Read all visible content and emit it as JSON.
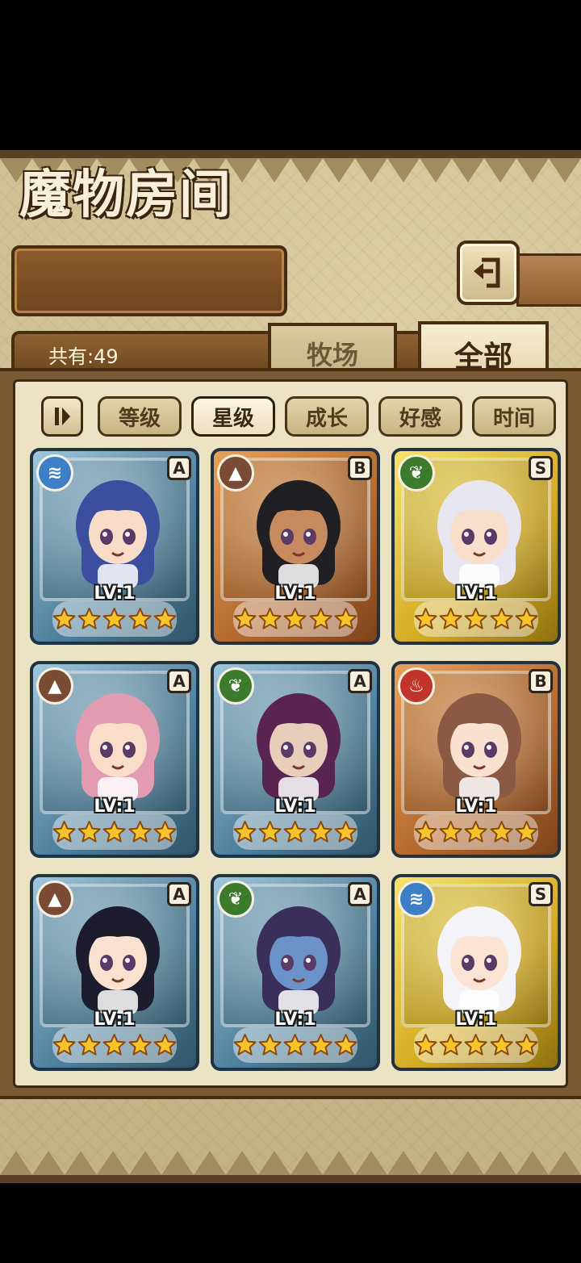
{
  "header": {
    "title": "魔物房间",
    "count_label": "共有:49"
  },
  "tabs": [
    {
      "label": "牧场",
      "active": false
    },
    {
      "label": "全部",
      "active": true
    }
  ],
  "filters": [
    {
      "label": "等级",
      "active": false
    },
    {
      "label": "星级",
      "active": true
    },
    {
      "label": "成长",
      "active": false
    },
    {
      "label": "好感",
      "active": false
    },
    {
      "label": "时间",
      "active": false
    }
  ],
  "monsters": [
    {
      "element": "water-icon",
      "grade": "A",
      "level": "LV:1",
      "stars": 5,
      "rarity": "a",
      "hair": "#3b4f9e",
      "skin": "#f8dcc8"
    },
    {
      "element": "earth-icon",
      "grade": "B",
      "level": "LV:1",
      "stars": 5,
      "rarity": "b",
      "hair": "#1f1f24",
      "skin": "#c68a5e"
    },
    {
      "element": "leaf-icon",
      "grade": "S",
      "level": "LV:1",
      "stars": 5,
      "rarity": "s",
      "hair": "#e8e6f0",
      "skin": "#f9dfcb"
    },
    {
      "element": "earth-icon",
      "grade": "A",
      "level": "LV:1",
      "stars": 5,
      "rarity": "a",
      "hair": "#e39bb2",
      "skin": "#f9ddc8"
    },
    {
      "element": "leaf-icon",
      "grade": "A",
      "level": "LV:1",
      "stars": 5,
      "rarity": "a",
      "hair": "#5a2452",
      "skin": "#e9cdbb"
    },
    {
      "element": "fire-icon",
      "grade": "B",
      "level": "LV:1",
      "stars": 5,
      "rarity": "b",
      "hair": "#8a5a44",
      "skin": "#fae1cf"
    },
    {
      "element": "earth-icon",
      "grade": "A",
      "level": "LV:1",
      "stars": 5,
      "rarity": "a",
      "hair": "#1c1c2c",
      "skin": "#fbe2d0"
    },
    {
      "element": "leaf-icon",
      "grade": "A",
      "level": "LV:1",
      "stars": 5,
      "rarity": "a",
      "hair": "#3a2f5a",
      "skin": "#6b93c9"
    },
    {
      "element": "water-icon",
      "grade": "S",
      "level": "LV:1",
      "stars": 5,
      "rarity": "s",
      "hair": "#f4f4f8",
      "skin": "#fbe4d4"
    }
  ]
}
